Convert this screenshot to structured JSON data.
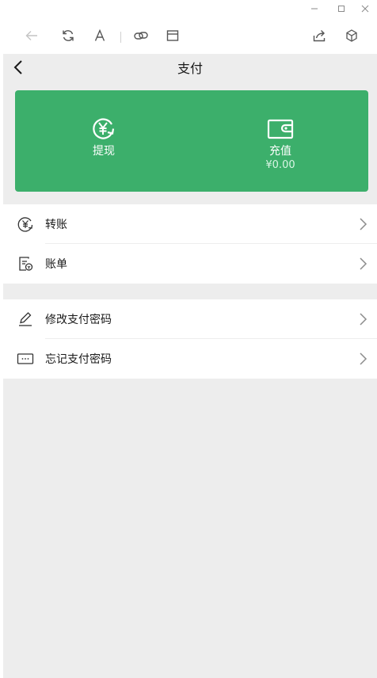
{
  "window": {
    "minimize_icon": "minimize-icon",
    "maximize_icon": "maximize-icon",
    "close_icon": "close-icon"
  },
  "toolbar": {
    "icons": [
      "back-arrow-icon",
      "refresh-icon",
      "font-size-icon",
      "link-icon",
      "window-icon",
      "share-icon",
      "cube-icon"
    ]
  },
  "nav": {
    "title": "支付"
  },
  "card": {
    "withdraw_label": "提现",
    "topup_label": "充值",
    "balance": "¥0.00",
    "color": "#3caf6b"
  },
  "menu_group1": [
    {
      "label": "转账",
      "icon": "transfer-icon"
    },
    {
      "label": "账单",
      "icon": "bill-icon"
    }
  ],
  "menu_group2": [
    {
      "label": "修改支付密码",
      "icon": "edit-pen-icon"
    },
    {
      "label": "忘记支付密码",
      "icon": "keyboard-icon"
    }
  ]
}
